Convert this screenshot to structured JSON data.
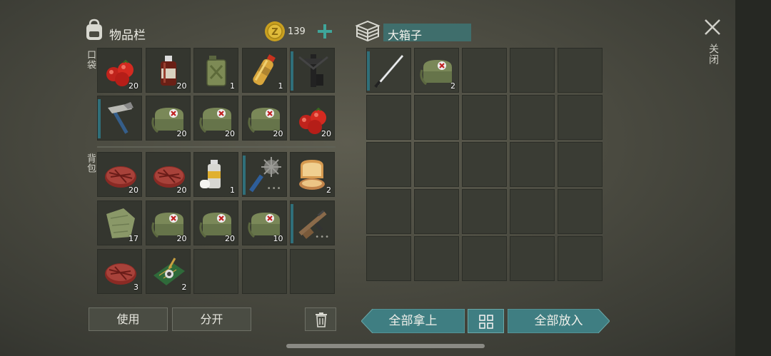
{
  "inventory": {
    "title": "物品栏",
    "coins": "139",
    "pocket_label": "口袋",
    "backpack_label": "背包",
    "pocket": [
      {
        "icon": "tomato-icon",
        "count": "20",
        "bar": false
      },
      {
        "icon": "bottle-icon",
        "count": "20",
        "bar": false
      },
      {
        "icon": "jerrycan-icon",
        "count": "1",
        "bar": false
      },
      {
        "icon": "water-bottle-icon",
        "count": "1",
        "bar": false
      },
      {
        "icon": "crossbow-icon",
        "count": "",
        "bar": true
      },
      {
        "icon": "hammer-icon",
        "count": "",
        "bar": true
      },
      {
        "icon": "medkit-bag-icon",
        "count": "20",
        "bar": false
      },
      {
        "icon": "medkit-bag-icon",
        "count": "20",
        "bar": false
      },
      {
        "icon": "medkit-bag-icon",
        "count": "20",
        "bar": false
      },
      {
        "icon": "tomato-icon",
        "count": "20",
        "bar": false
      }
    ],
    "backpack": [
      {
        "icon": "steak-icon",
        "count": "20",
        "bar": false
      },
      {
        "icon": "steak-icon",
        "count": "20",
        "bar": false
      },
      {
        "icon": "spray-can-icon",
        "count": "1",
        "bar": false
      },
      {
        "icon": "spiked-mace-icon",
        "count": "",
        "bar": true,
        "dots": true
      },
      {
        "icon": "toast-icon",
        "count": "2",
        "bar": false
      },
      {
        "icon": "cloth-icon",
        "count": "17",
        "bar": false
      },
      {
        "icon": "medkit-bag-icon",
        "count": "20",
        "bar": false
      },
      {
        "icon": "medkit-bag-icon",
        "count": "20",
        "bar": false
      },
      {
        "icon": "medkit-bag-icon",
        "count": "10",
        "bar": false
      },
      {
        "icon": "rifle-icon",
        "count": "",
        "bar": true,
        "dots": true
      },
      {
        "icon": "steak-icon",
        "count": "3",
        "bar": false
      },
      {
        "icon": "circuit-board-icon",
        "count": "2",
        "bar": false
      },
      {
        "icon": "",
        "count": "",
        "bar": false
      },
      {
        "icon": "",
        "count": "",
        "bar": false
      },
      {
        "icon": "",
        "count": "",
        "bar": false
      }
    ],
    "buttons": {
      "use": "使用",
      "split": "分开"
    }
  },
  "container": {
    "name": "大箱子",
    "items": [
      {
        "icon": "katana-icon",
        "count": "",
        "bar": true
      },
      {
        "icon": "medkit-bag-icon",
        "count": "2",
        "bar": false
      }
    ],
    "buttons": {
      "take_all": "全部拿上",
      "put_all": "全部放入"
    }
  },
  "close_label": "关闭",
  "colors": {
    "accent": "#2f6f7a",
    "button_teal": "#3f7e82",
    "name_field": "#3f6e6c"
  }
}
